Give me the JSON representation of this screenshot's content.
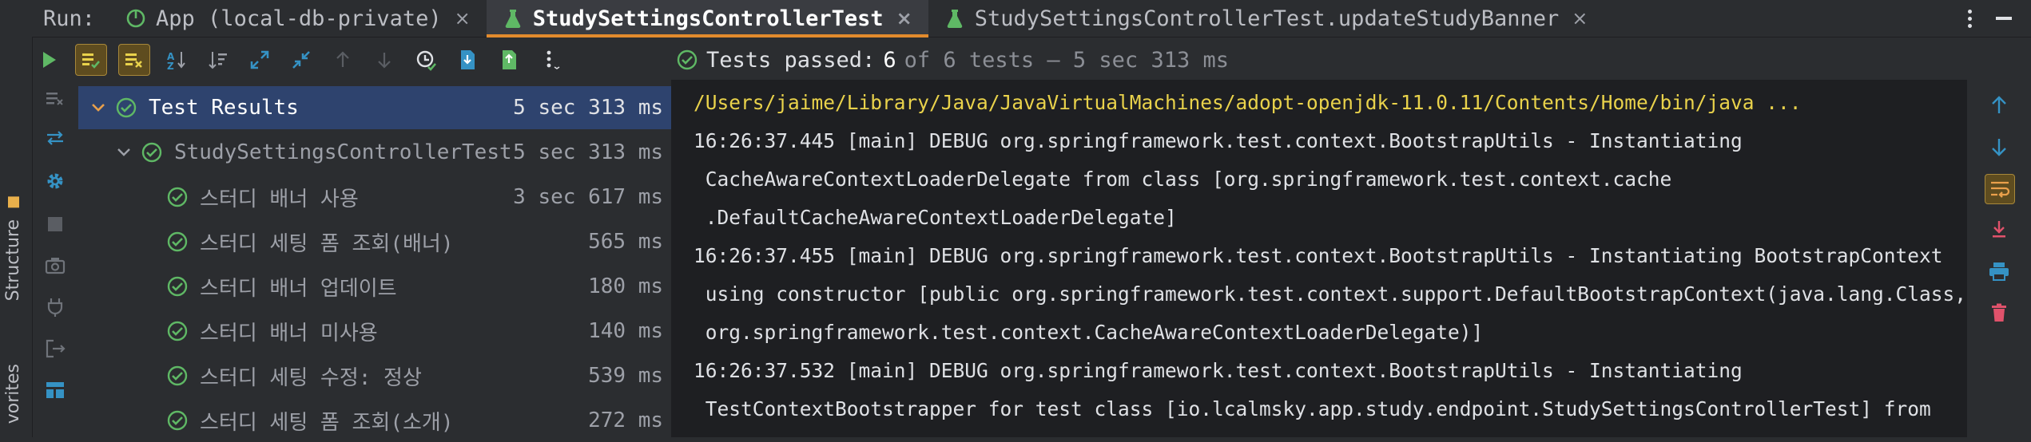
{
  "tabbar": {
    "run_label": "Run:",
    "tabs": [
      {
        "label": "App (local-db-private)",
        "icon": "spring-boot-icon",
        "active": false
      },
      {
        "label": "StudySettingsControllerTest",
        "icon": "test-flask-icon",
        "active": true
      },
      {
        "label": "StudySettingsControllerTest.updateStudyBanner",
        "icon": "test-flask-icon",
        "active": false
      }
    ],
    "close_glyph": "×"
  },
  "side_labels": {
    "structure": "Structure",
    "favorites": "vorites"
  },
  "toolbar": {
    "buttons": [
      "rerun-icon",
      "show-passed-icon",
      "show-ignored-icon",
      "sort-alpha-icon",
      "sort-duration-icon",
      "expand-all-icon",
      "collapse-all-icon",
      "previous-failed-icon",
      "next-failed-icon",
      "test-history-icon",
      "import-tests-icon",
      "export-tests-icon",
      "more-icon"
    ],
    "status": {
      "passed_label": "Tests passed:",
      "passed_count": "6",
      "rest": "of 6 tests – 5 sec 313 ms"
    }
  },
  "tree": {
    "root": {
      "name": "Test Results",
      "time": "5 sec 313 ms"
    },
    "suite": {
      "name": "StudySettingsControllerTest",
      "time": "5 sec 313 ms"
    },
    "tests": [
      {
        "name": "스터디 배너 사용",
        "time": "3 sec 617 ms"
      },
      {
        "name": "스터디 세팅 폼 조회(배너)",
        "time": "565 ms"
      },
      {
        "name": "스터디 배너 업데이트",
        "time": "180 ms"
      },
      {
        "name": "스터디 배너 미사용",
        "time": "140 ms"
      },
      {
        "name": "스터디 세팅 수정: 정상",
        "time": "539 ms"
      },
      {
        "name": "스터디 세팅 폼 조회(소개)",
        "time": "272 ms"
      }
    ]
  },
  "console": {
    "lines": [
      "/Users/jaime/Library/Java/JavaVirtualMachines/adopt-openjdk-11.0.11/Contents/Home/bin/java ...",
      "16:26:37.445 [main] DEBUG org.springframework.test.context.BootstrapUtils - Instantiating",
      " CacheAwareContextLoaderDelegate from class [org.springframework.test.context.cache",
      " .DefaultCacheAwareContextLoaderDelegate]",
      "16:26:37.455 [main] DEBUG org.springframework.test.context.BootstrapUtils - Instantiating BootstrapContext",
      " using constructor [public org.springframework.test.context.support.DefaultBootstrapContext(java.lang.Class,",
      " org.springframework.test.context.CacheAwareContextLoaderDelegate)]",
      "16:26:37.532 [main] DEBUG org.springframework.test.context.BootstrapUtils - Instantiating",
      " TestContextBootstrapper for test class [io.lcalmsky.app.study.endpoint.StudySettingsControllerTest] from"
    ]
  },
  "colors": {
    "accent": "#e28b2d",
    "pass": "#5fb865",
    "path": "#e9d24b",
    "selection": "#2e436e",
    "blue": "#3592c4",
    "red": "#e0526b"
  }
}
